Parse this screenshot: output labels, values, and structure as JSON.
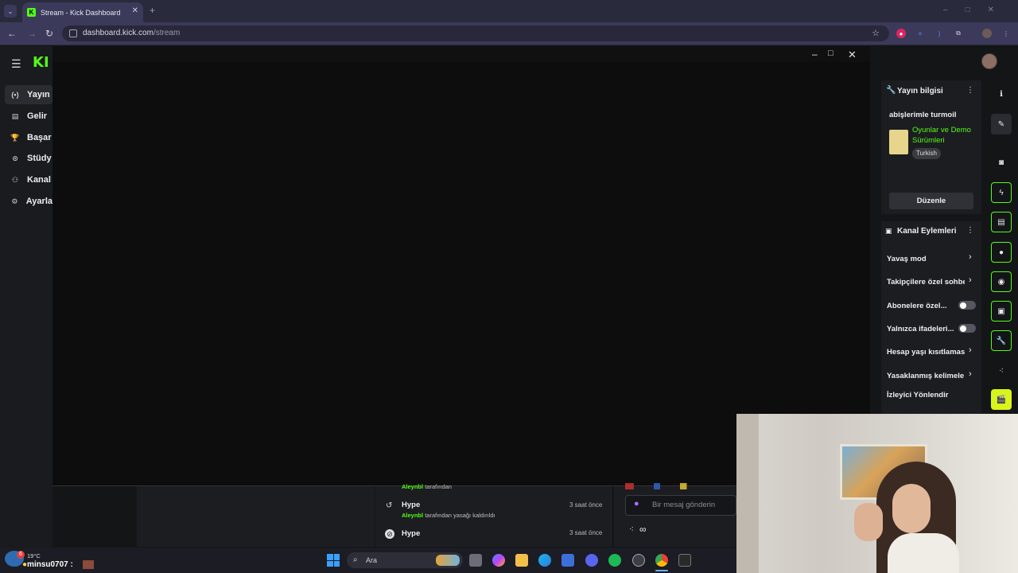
{
  "browser": {
    "tab_title": "Stream - Kick Dashboard",
    "tab_icon_letter": "K",
    "url_domain": "dashboard.kick.com",
    "url_path": "/stream"
  },
  "nav": {
    "logo": "KI",
    "items": [
      {
        "icon": "(•)",
        "label": "Yayın"
      },
      {
        "icon": "▤",
        "label": "Gelir"
      },
      {
        "icon": "🏆",
        "label": "Başar"
      },
      {
        "icon": "⊙",
        "label": "Stüdy"
      },
      {
        "icon": "⚇",
        "label": "Kanal"
      },
      {
        "icon": "⚙",
        "label": "Ayarla"
      }
    ]
  },
  "stream_info": {
    "title": "Yayın bilgisi",
    "stream_title": "abişlerimle turmoil",
    "category": "Oyunlar ve Demo Sürümleri",
    "language_tag": "Turkish",
    "edit_button": "Düzenle"
  },
  "channel_actions": {
    "title": "Kanal Eylemleri",
    "rows": [
      {
        "label": "Yavaş mod",
        "control": "chevron"
      },
      {
        "label": "Takipçilere özel sohbe",
        "control": "chevron"
      },
      {
        "label": "Abonelere özel...",
        "control": "toggle"
      },
      {
        "label": "Yalnızca ifadeleri...",
        "control": "toggle"
      },
      {
        "label": "Hesap yaşı kısıtlaması",
        "control": "chevron"
      },
      {
        "label": "Yasaklanmış kelimele",
        "control": "chevron"
      },
      {
        "label": "İzleyici Yönlendir",
        "control": "none"
      }
    ]
  },
  "mod_log": [
    {
      "actor": "Aleynbl",
      "action": "tarafından",
      "time": ""
    },
    {
      "user": "Hype",
      "actor": "Aleynbl",
      "action": "tarafından yasağı kaldırıldı",
      "time": "3 saat önce"
    },
    {
      "user": "Hype",
      "actor": "",
      "action": "",
      "time": "3 saat önce"
    }
  ],
  "chat": {
    "placeholder": "Bir mesaj gönderin",
    "footer_icon": "∞"
  },
  "taskbar": {
    "weather_temp": "19°C",
    "weather_badge": "6",
    "user_label": "minsu0707 :",
    "search_label": "Ara"
  },
  "colors": {
    "kick_green": "#53fc18",
    "highlight_yellow": "#d8f41a"
  }
}
